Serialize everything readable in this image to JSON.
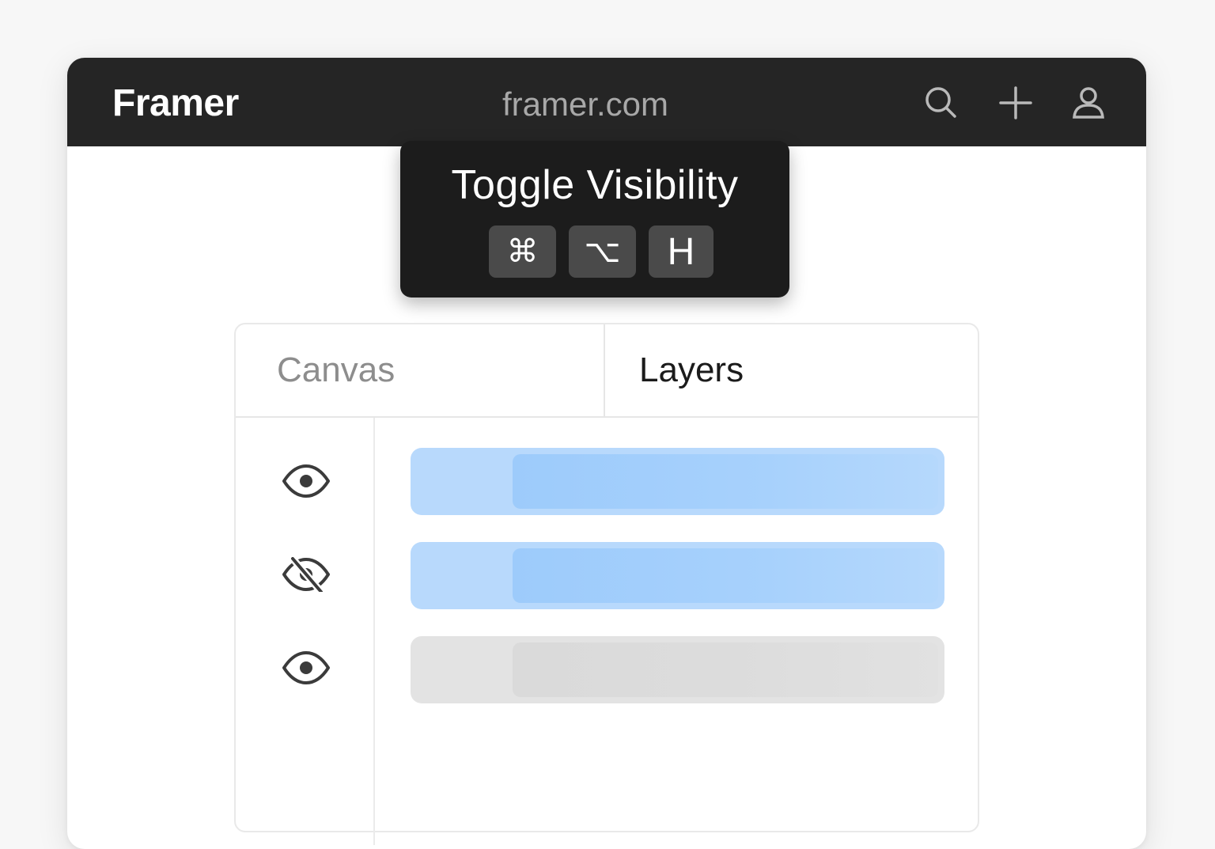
{
  "app": {
    "logo": "Framer",
    "url": "framer.com"
  },
  "toolbar_icons": [
    "search-icon",
    "plus-icon",
    "user-icon"
  ],
  "tooltip": {
    "title": "Toggle Visibility",
    "keys": [
      "⌘",
      "⌥",
      "H"
    ]
  },
  "tabs": [
    {
      "label": "Canvas",
      "active": false
    },
    {
      "label": "Layers",
      "active": true
    }
  ],
  "layers": [
    {
      "visibility_icon": "eye-icon",
      "visible": true,
      "selected": true
    },
    {
      "visibility_icon": "eye-off-icon",
      "visible": false,
      "selected": true
    },
    {
      "visibility_icon": "eye-icon",
      "visible": true,
      "selected": false
    }
  ],
  "colors": {
    "topbar": "#252525",
    "tooltip": "#1c1c1c",
    "selected_layer": "#b8d9fc",
    "unselected_layer": "#e3e3e3"
  }
}
